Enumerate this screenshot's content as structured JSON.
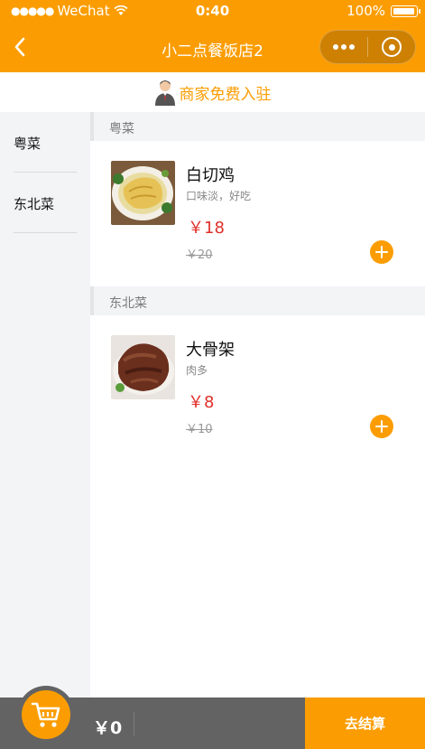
{
  "status_bar": {
    "carrier": "WeChat",
    "time": "0:40",
    "battery": "100%",
    "battery_level": 1.0
  },
  "nav": {
    "title": "小二点餐饭店2"
  },
  "banner": {
    "text": "商家免费入驻"
  },
  "sidebar": {
    "items": [
      {
        "label": "粤菜"
      },
      {
        "label": "东北菜"
      }
    ]
  },
  "categories": [
    {
      "title": "粤菜",
      "dishes": [
        {
          "name": "白切鸡",
          "desc": "口味淡，好吃",
          "price": "￥18",
          "old_price": "￥20"
        }
      ]
    },
    {
      "title": "东北菜",
      "dishes": [
        {
          "name": "大骨架",
          "desc": "肉多",
          "price": "￥8",
          "old_price": "￥10"
        }
      ]
    }
  ],
  "cart": {
    "total": "￥0",
    "checkout_label": "去结算"
  },
  "colors": {
    "accent": "#fb9d02",
    "price": "#e0302a",
    "bottom_bar": "#636363",
    "sidebar_bg": "#f3f4f6"
  },
  "icons": {
    "back": "chevron-left-icon",
    "more": "more-dots-icon",
    "close": "target-icon",
    "merchant": "merchant-avatar-icon",
    "add": "plus-icon",
    "cart": "cart-icon",
    "wifi": "wifi-icon",
    "battery": "battery-icon"
  }
}
